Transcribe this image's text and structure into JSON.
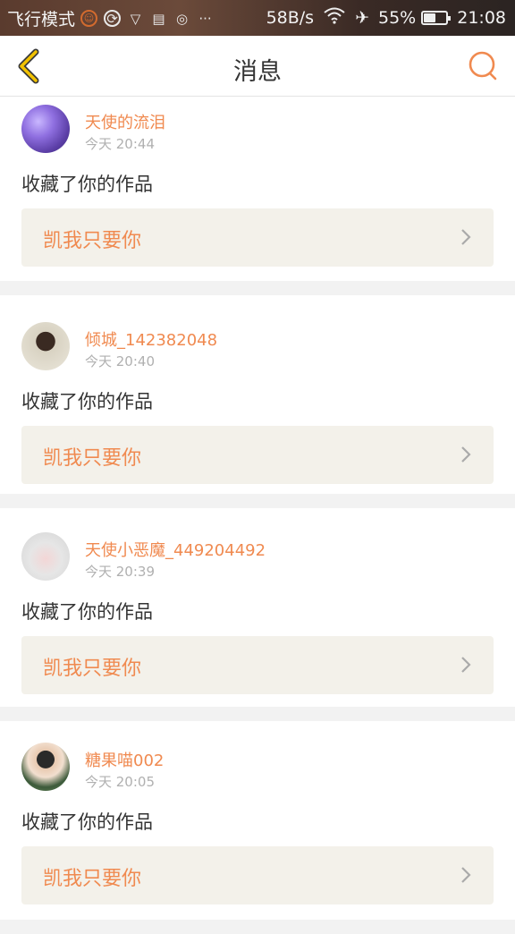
{
  "status_bar": {
    "mode": "飞行模式",
    "speed": "58B/s",
    "battery": "55%",
    "battery_level": 0.55,
    "time": "21:08"
  },
  "nav": {
    "title": "消息"
  },
  "notifications": [
    {
      "username": "天使的流泪",
      "time": "今天 20:44",
      "action": "收藏了你的作品",
      "work_title": "凯我只要你"
    },
    {
      "username": "倾城_142382048",
      "time": "今天 20:40",
      "action": "收藏了你的作品",
      "work_title": "凯我只要你"
    },
    {
      "username": "天使小恶魔_449204492",
      "time": "今天 20:39",
      "action": "收藏了你的作品",
      "work_title": "凯我只要你"
    },
    {
      "username": "糖果喵002",
      "time": "今天 20:05",
      "action": "收藏了你的作品",
      "work_title": "凯我只要你"
    }
  ],
  "colors": {
    "accent": "#f08a50",
    "back_icon": "#f2c200",
    "card_bg": "#f3f1ea"
  }
}
